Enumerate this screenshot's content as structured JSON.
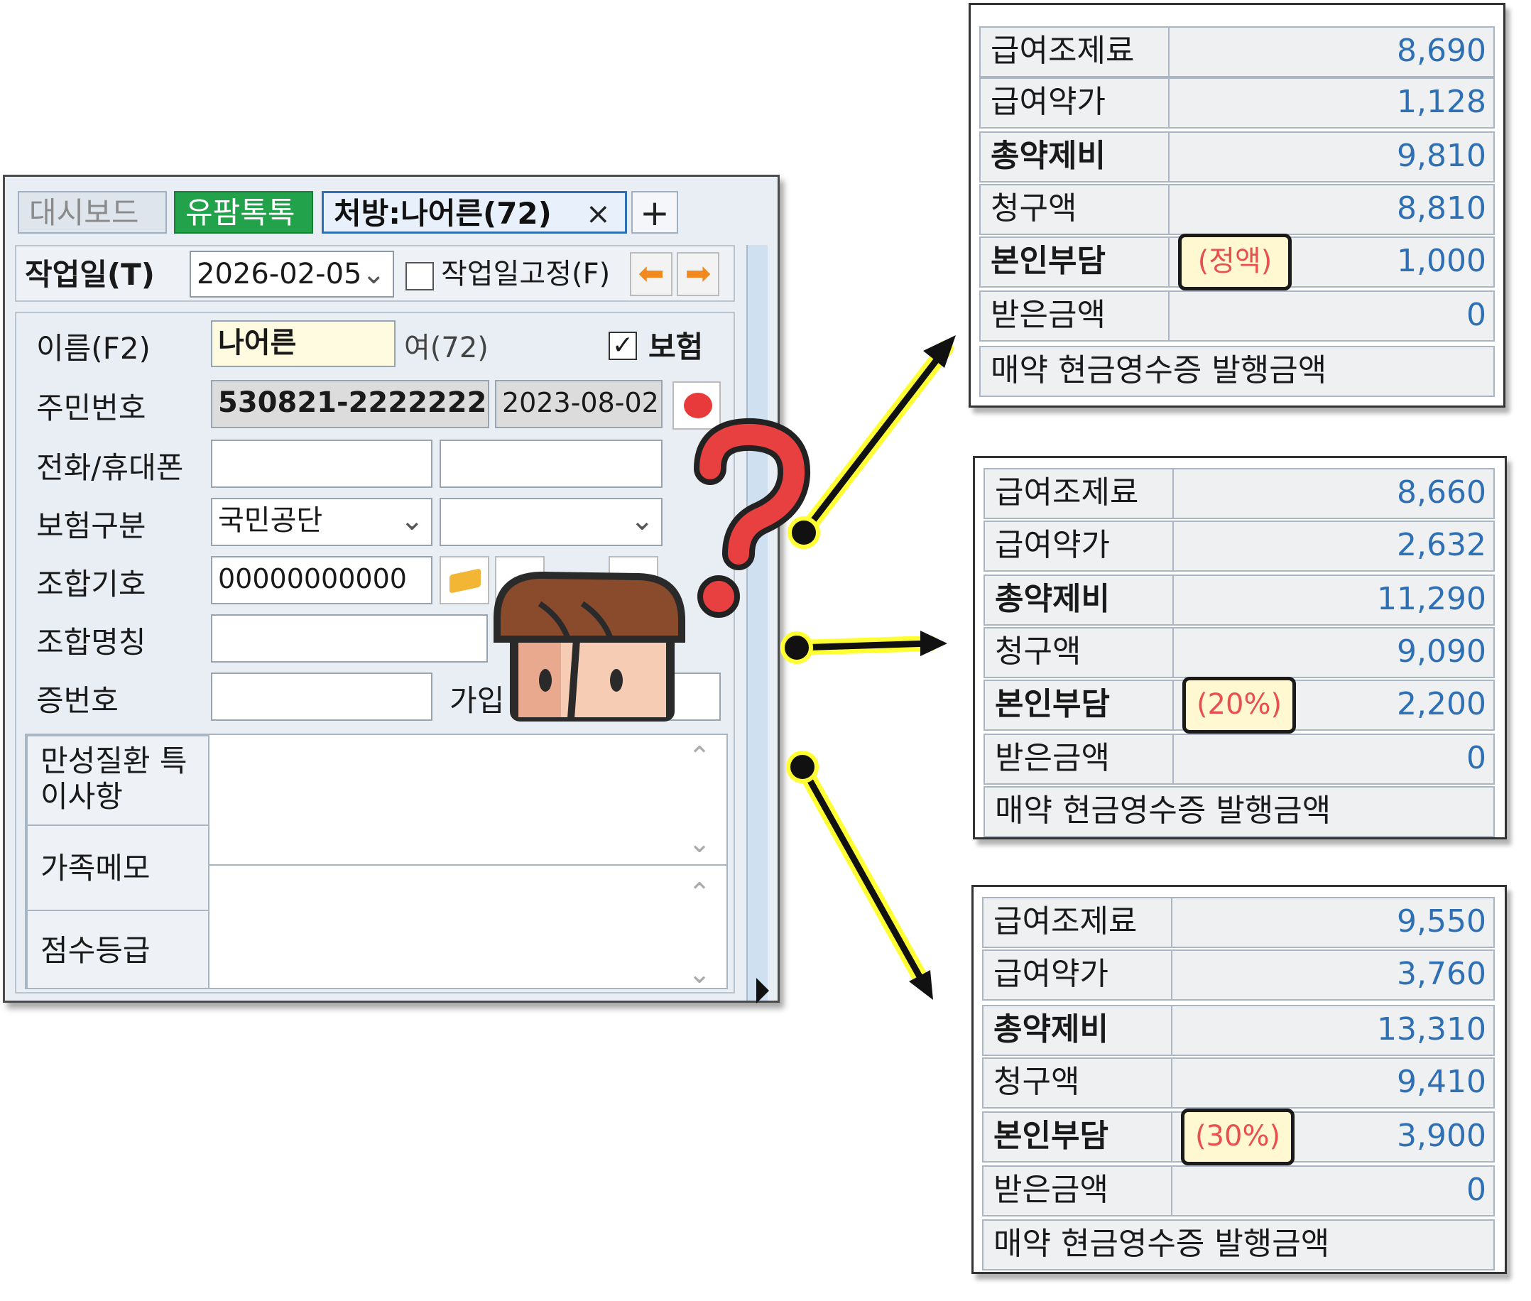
{
  "tabs": {
    "dashboard": "대시보드",
    "yupam": "유팜톡톡",
    "prescription": "처방:나어른(72)",
    "close": "×",
    "add": "+"
  },
  "toolbar": {
    "work_date_label": "작업일(T)",
    "work_date": "2026-02-05",
    "fix_label": "작업일고정(F)",
    "prev": "⬅",
    "next": "➡"
  },
  "form": {
    "name_label": "이름(F2)",
    "name_value": "나어른",
    "gender_age": "여(72)",
    "insurance_label": "보험",
    "rrn_label": "주민번호",
    "rrn_value": "530821-2222222",
    "rrn_date": "2023-08-02",
    "phone_label": "전화/휴대폰",
    "ins_type_label": "보험구분",
    "ins_type_value": "국민공단",
    "union_code_label": "조합기호",
    "union_code_value": "00000000000",
    "union_name_label": "조합명칭",
    "cert_no_label": "증번호",
    "join_label": "가입",
    "chronic_label": "만성질환 특이사항",
    "family_memo_label": "가족메모",
    "score_label": "점수등급"
  },
  "panels": [
    {
      "rows": [
        {
          "label": "급여조제료",
          "value": "8,690"
        },
        {
          "label": "급여약가",
          "value": "1,128"
        },
        {
          "label": "총약제비",
          "value": "9,810"
        },
        {
          "label": "청구액",
          "value": "8,810"
        },
        {
          "label": "본인부담",
          "value": "1,000"
        },
        {
          "label": "받은금액",
          "value": "0"
        }
      ],
      "tag": "(정액)",
      "footer": "매약 현금영수증 발행금액"
    },
    {
      "rows": [
        {
          "label": "급여조제료",
          "value": "8,660"
        },
        {
          "label": "급여약가",
          "value": "2,632"
        },
        {
          "label": "총약제비",
          "value": "11,290"
        },
        {
          "label": "청구액",
          "value": "9,090"
        },
        {
          "label": "본인부담",
          "value": "2,200"
        },
        {
          "label": "받은금액",
          "value": "0"
        }
      ],
      "tag": "(20%)",
      "footer": "매약 현금영수증 발행금액"
    },
    {
      "rows": [
        {
          "label": "급여조제료",
          "value": "9,550"
        },
        {
          "label": "급여약가",
          "value": "3,760"
        },
        {
          "label": "총약제비",
          "value": "13,310"
        },
        {
          "label": "청구액",
          "value": "9,410"
        },
        {
          "label": "본인부담",
          "value": "3,900"
        },
        {
          "label": "받은금액",
          "value": "0"
        }
      ],
      "tag": "(30%)",
      "footer": "매약 현금영수증 발행금액"
    }
  ],
  "colors": {
    "tab_green": "#22a24a",
    "value_blue": "#2f6fb3",
    "tag_red": "#e85050",
    "highlight_yellow": "#ffff33",
    "question_red": "#e84040"
  }
}
